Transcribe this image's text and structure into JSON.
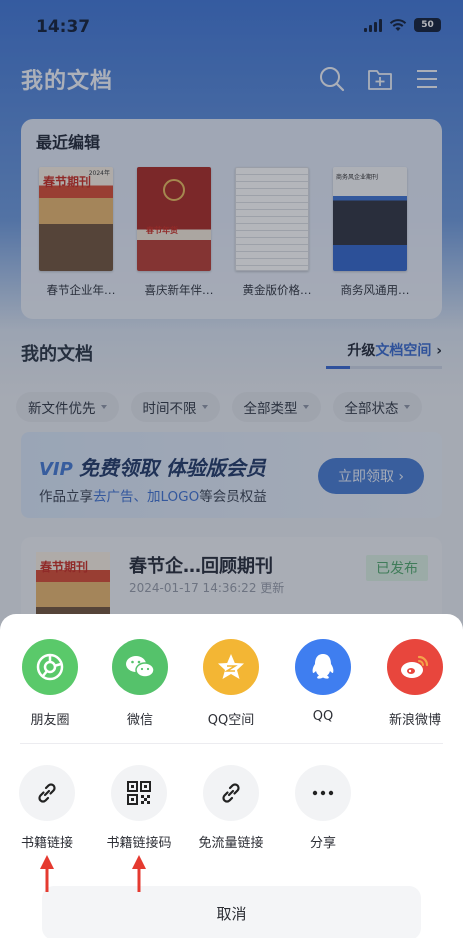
{
  "status_bar": {
    "time": "14:37",
    "battery": "50"
  },
  "header": {
    "title": "我的文档"
  },
  "recent": {
    "title": "最近编辑",
    "items": [
      {
        "caption": "春节企业年…",
        "cover_text": "春节期刊",
        "cover_year": "2024年"
      },
      {
        "caption": "喜庆新年伴…",
        "cover_text": "春节年货"
      },
      {
        "caption": "黄金版价格…"
      },
      {
        "caption": "商务风通用…",
        "cover_text": "商务风企业期刊"
      }
    ]
  },
  "my_docs": {
    "title": "我的文档",
    "upgrade_prefix": "升级",
    "upgrade_highlight": "文档空间",
    "upgrade_chevron": "›"
  },
  "filters": [
    "新文件优先",
    "时间不限",
    "全部类型",
    "全部状态"
  ],
  "vip_banner": {
    "vip_mark": "VIP",
    "title": "免费领取 体验版会员",
    "desc_pre": "作品立享",
    "desc_hl1": "去广告",
    "desc_sep": "、",
    "desc_hl2": "加LOGO",
    "desc_post": "等会员权益",
    "cta": "立即领取 ›"
  },
  "doc_item": {
    "title": "春节企…回顾期刊",
    "date": "2024-01-17 14:36:22 更新",
    "status": "已发布",
    "cover_text": "春节期刊"
  },
  "share_sheet": {
    "row1": [
      {
        "label": "朋友圈",
        "icon": "moments-icon",
        "color": "#5ac96a"
      },
      {
        "label": "微信",
        "icon": "wechat-icon",
        "color": "#55c26b"
      },
      {
        "label": "QQ空间",
        "icon": "qzone-icon",
        "color": "#f3b634"
      },
      {
        "label": "QQ",
        "icon": "qq-icon",
        "color": "#3f7ef0"
      },
      {
        "label": "新浪微博",
        "icon": "weibo-icon",
        "color": "#e8463d"
      }
    ],
    "row2": [
      {
        "label": "书籍链接",
        "icon": "link-icon"
      },
      {
        "label": "书籍链接码",
        "icon": "qr-code-icon"
      },
      {
        "label": "免流量链接",
        "icon": "link-icon"
      },
      {
        "label": "分享",
        "icon": "more-icon"
      }
    ],
    "cancel": "取消"
  },
  "annotations": {
    "arrow_color": "#e53a30"
  }
}
